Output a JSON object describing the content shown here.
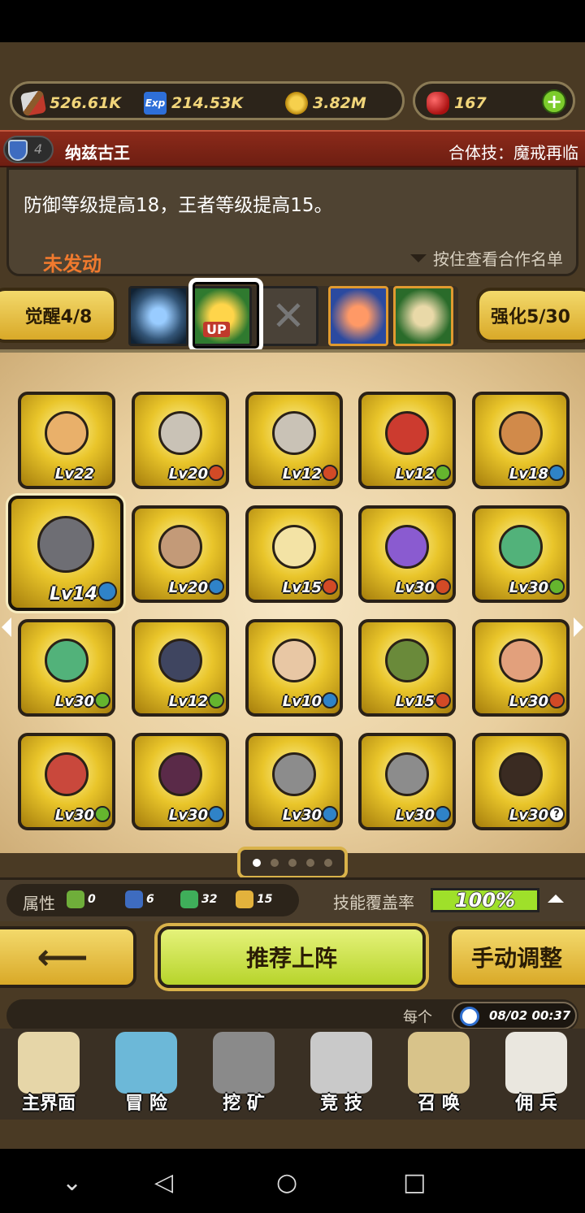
{
  "resources": {
    "attack": "526.61K",
    "exp": "214.53K",
    "exp_icon_text": "Exp",
    "gold": "3.82M",
    "gems": "167",
    "add": "+"
  },
  "team": {
    "shield_level": "4",
    "name": "纳兹古王",
    "combo": "合体技：魔戒再临"
  },
  "description": {
    "text": "防御等级提高18，王者等级提高15。",
    "status": "未发动",
    "hold_hint": "按住查看合作名单"
  },
  "awaken": {
    "label": "觉醒4/8"
  },
  "enhance": {
    "label": "强化5/30"
  },
  "skills": {
    "up_label": "UP",
    "empty_mark": "✕",
    "icons": [
      "magic-circle-icon",
      "crown-up-icon",
      "empty-slot-icon",
      "flame-sword-icon",
      "scroll-icon"
    ]
  },
  "heroes": [
    {
      "lv": "Lv22",
      "badge": "none",
      "color": "#e9b06a"
    },
    {
      "lv": "Lv20",
      "badge": "red",
      "color": "#c9c2b6"
    },
    {
      "lv": "Lv12",
      "badge": "red",
      "color": "#c9c2b6"
    },
    {
      "lv": "Lv12",
      "badge": "green",
      "color": "#cc3b2f"
    },
    {
      "lv": "Lv18",
      "badge": "blue",
      "color": "#d18a4a"
    },
    {
      "lv": "Lv14",
      "badge": "blue",
      "color": "#6e6e74"
    },
    {
      "lv": "Lv20",
      "badge": "blue",
      "color": "#c39a78"
    },
    {
      "lv": "Lv15",
      "badge": "red",
      "color": "#f3e3a5"
    },
    {
      "lv": "Lv30",
      "badge": "red",
      "color": "#8a5bd0"
    },
    {
      "lv": "Lv30",
      "badge": "green",
      "color": "#52b27a"
    },
    {
      "lv": "Lv30",
      "badge": "green",
      "color": "#52b27a"
    },
    {
      "lv": "Lv12",
      "badge": "green",
      "color": "#3f4560"
    },
    {
      "lv": "Lv10",
      "badge": "blue",
      "color": "#e8c7a4"
    },
    {
      "lv": "Lv15",
      "badge": "red",
      "color": "#6a8a3a"
    },
    {
      "lv": "Lv30",
      "badge": "red",
      "color": "#e2a07c"
    },
    {
      "lv": "Lv30",
      "badge": "green",
      "color": "#c9483c"
    },
    {
      "lv": "Lv30",
      "badge": "blue",
      "color": "#5a2a48"
    },
    {
      "lv": "Lv30",
      "badge": "blue",
      "color": "#8c8c8c"
    },
    {
      "lv": "Lv30",
      "badge": "blue",
      "color": "#8c8c8c"
    },
    {
      "lv": "Lv30",
      "badge": "help",
      "color": "#3a2b22"
    }
  ],
  "pagination": {
    "current": 1,
    "total": 5
  },
  "stats": {
    "label": "属性",
    "items": [
      {
        "icon": "plant-icon",
        "value": "0",
        "color": "#6fae3a"
      },
      {
        "icon": "shield-icon",
        "value": "6",
        "color": "#3e6cc0"
      },
      {
        "icon": "wing-icon",
        "value": "32",
        "color": "#3fae5a"
      },
      {
        "icon": "crown-icon",
        "value": "15",
        "color": "#e3b23c"
      }
    ],
    "coverage_label": "技能覆盖率",
    "coverage": "100%"
  },
  "buttons": {
    "back": "⟵",
    "recommend": "推荐上阵",
    "manual": "手动调整"
  },
  "message": {
    "each": "每个",
    "time": "08/02 00:37"
  },
  "nav": [
    {
      "label": "主界面",
      "icon": "map-scroll-icon"
    },
    {
      "label": "冒 险",
      "icon": "island-icon"
    },
    {
      "label": "挖 矿",
      "icon": "pickaxe-icon"
    },
    {
      "label": "竞 技",
      "icon": "crossed-swords-icon"
    },
    {
      "label": "召 唤",
      "icon": "summon-scroll-icon"
    },
    {
      "label": "佣 兵",
      "icon": "tent-icon"
    }
  ],
  "system_nav": {
    "back": "◁",
    "home": "○",
    "recents": "□",
    "down": "⌄"
  }
}
